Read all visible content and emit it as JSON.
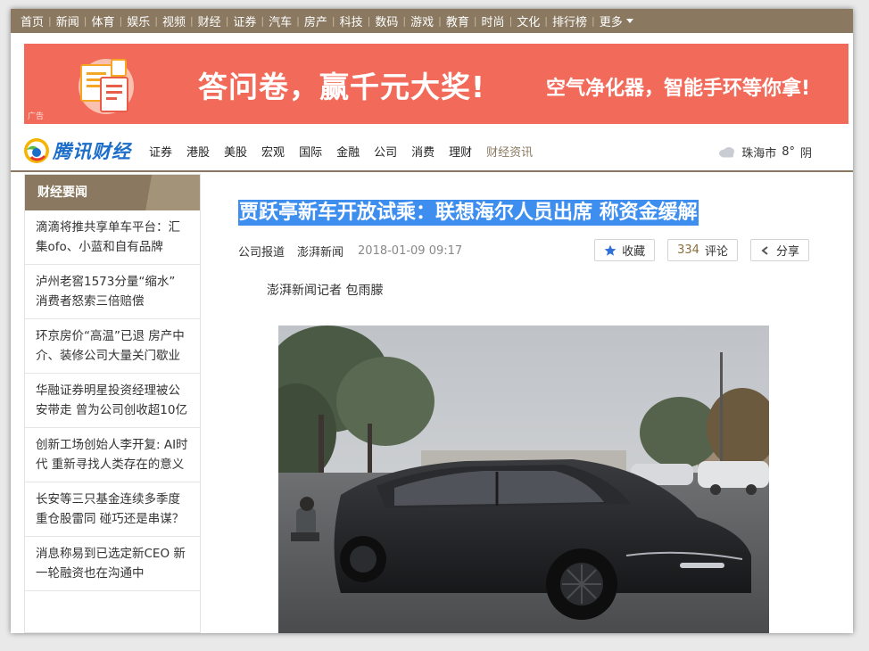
{
  "topnav": {
    "items": [
      "首页",
      "新闻",
      "体育",
      "娱乐",
      "视频",
      "财经",
      "证券",
      "汽车",
      "房产",
      "科技",
      "数码",
      "游戏",
      "教育",
      "时尚",
      "文化",
      "排行榜"
    ],
    "more_label": "更多"
  },
  "ad": {
    "label": "广告",
    "headline": "答问卷，赢千元大奖!",
    "subline": "空气净化器，智能手环等你拿!"
  },
  "channel": {
    "logo_text": "腾讯财经",
    "items": [
      "证券",
      "港股",
      "美股",
      "宏观",
      "国际",
      "金融",
      "公司",
      "消费",
      "理财",
      "财经资讯"
    ],
    "current": "财经资讯"
  },
  "weather": {
    "city": "珠海市",
    "temp": "8°",
    "condition": "阴",
    "icon": "cloud-icon"
  },
  "sidebar": {
    "title": "财经要闻",
    "items": [
      "滴滴将推共享单车平台：汇集ofo、小蓝和自有品牌",
      "泸州老窖1573分量“缩水” 消费者怒索三倍赔偿",
      "环京房价“高温”已退 房产中介、装修公司大量关门歇业",
      "华融证券明星投资经理被公安带走 曾为公司创收超10亿",
      "创新工场创始人李开复: AI时代 重新寻找人类存在的意义",
      "长安等三只基金连续多季度重仓股雷同 碰巧还是串谋？",
      "消息称易到已选定新CEO 新一轮融资也在沟通中"
    ]
  },
  "article": {
    "title": "贾跃亭新车开放试乘：联想海尔人员出席 称资金缓解",
    "source_type": "公司报道",
    "source": "澎湃新闻",
    "datetime": "2018-01-09 09:17",
    "byline": "澎湃新闻记者 包雨朦"
  },
  "actions": {
    "favorite_label": "收藏",
    "comment_count": "334",
    "comment_label": "评论",
    "share_label": "分享"
  },
  "colors": {
    "nav_bg": "#8a7960",
    "ad_bg": "#f26a5a",
    "highlight": "#3d8eee",
    "logo_blue": "#1d6ec9"
  }
}
